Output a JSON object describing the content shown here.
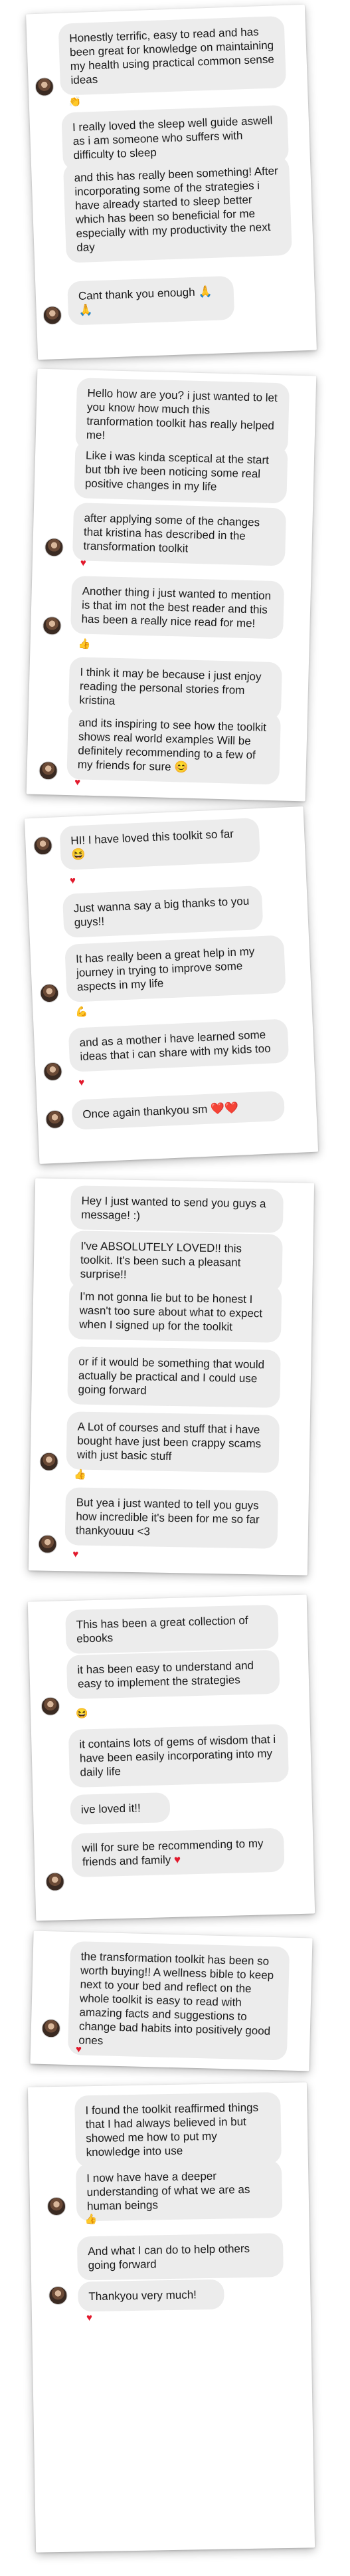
{
  "heart_glyph": "♥",
  "emoji_laugh": "😆",
  "emoji_clap": "👏",
  "emoji_smile": "😊",
  "emoji_thumb": "👍",
  "emoji_muscle": "💪",
  "emoji_pray": "🙏🙏",
  "emoji_hearts": "❤️❤️",
  "card1": {
    "m1": "Honestly terrific, easy to read and has been great for knowledge on maintaining my health using practical common sense ideas",
    "m2": "I really loved the sleep well guide aswell as i am someone who suffers with difficulty to sleep",
    "m3": "and this has really been something! After incorporating some of the strategies i have already started to sleep better which has been so beneficial for me especially with my productivity the next day",
    "m4": "Cant thank you enough"
  },
  "card2": {
    "m1": "Hello how are you? i just wanted to let you know how much this tranformation toolkit has really helped me!",
    "m2": "Like i was kinda sceptical at the start but tbh ive been noticing some real positive changes in my life",
    "m3": "after applying some of the changes that kristina has described in the transformation toolkit",
    "m4": "Another thing i just wanted to mention is that im not the best reader and this has been a really nice read for me!",
    "m5": "I think it may be because i just enjoy reading the personal stories from kristina",
    "m6": "and its inspiring to see how the toolkit shows real world examples Will be definitely recommending to a few of my friends for sure"
  },
  "card3": {
    "m1": "HI! I have loved this toolkit so far",
    "m2": "Just wanna say a big thanks to you guys!!",
    "m3": "It has really been a great help in my journey in trying to improve some aspects in my life",
    "m4": "and as a mother i have learned some ideas that i can share with my kids too",
    "m5": "Once again thankyou sm"
  },
  "card4": {
    "m1": "Hey I just wanted to send you guys a message! :)",
    "m2": "I've ABSOLUTELY LOVED!! this toolkit. It's been such a pleasant surprise!!",
    "m3": "I'm not gonna lie but to be honest I wasn't too sure about what to expect when I signed up for the toolkit",
    "m4": "or if it would be something that would actually be practical and I could use going forward",
    "m5": "A Lot of courses and stuff that i have bought have just been crappy scams with just basic stuff",
    "m6": "But yea i just wanted to tell you guys how incredible it's been for me so far thankyouuu <3"
  },
  "card5": {
    "m1": "This has been a great collection of ebooks",
    "m2": "it has been easy to understand and easy to implement the strategies",
    "m3": "it contains lots of gems of wisdom that i have been easily incorporating into my daily life",
    "m4": "ive loved it!!",
    "m5": "will for sure be recommending to my friends and family"
  },
  "card6": {
    "m1": "the transformation toolkit has been so worth buying!! A wellness bible to keep next to your bed and reflect on the whole toolkit is easy to read with amazing facts and suggestions to change bad habits into positively good ones"
  },
  "card7": {
    "m1": "I found the toolkit reaffirmed things that I had always believed in but showed me how to put my knowledge into use",
    "m2": "I now have have a deeper understanding of what we are as human beings",
    "m3": "And what I can do to help others going forward",
    "m4": "Thankyou very much!"
  }
}
